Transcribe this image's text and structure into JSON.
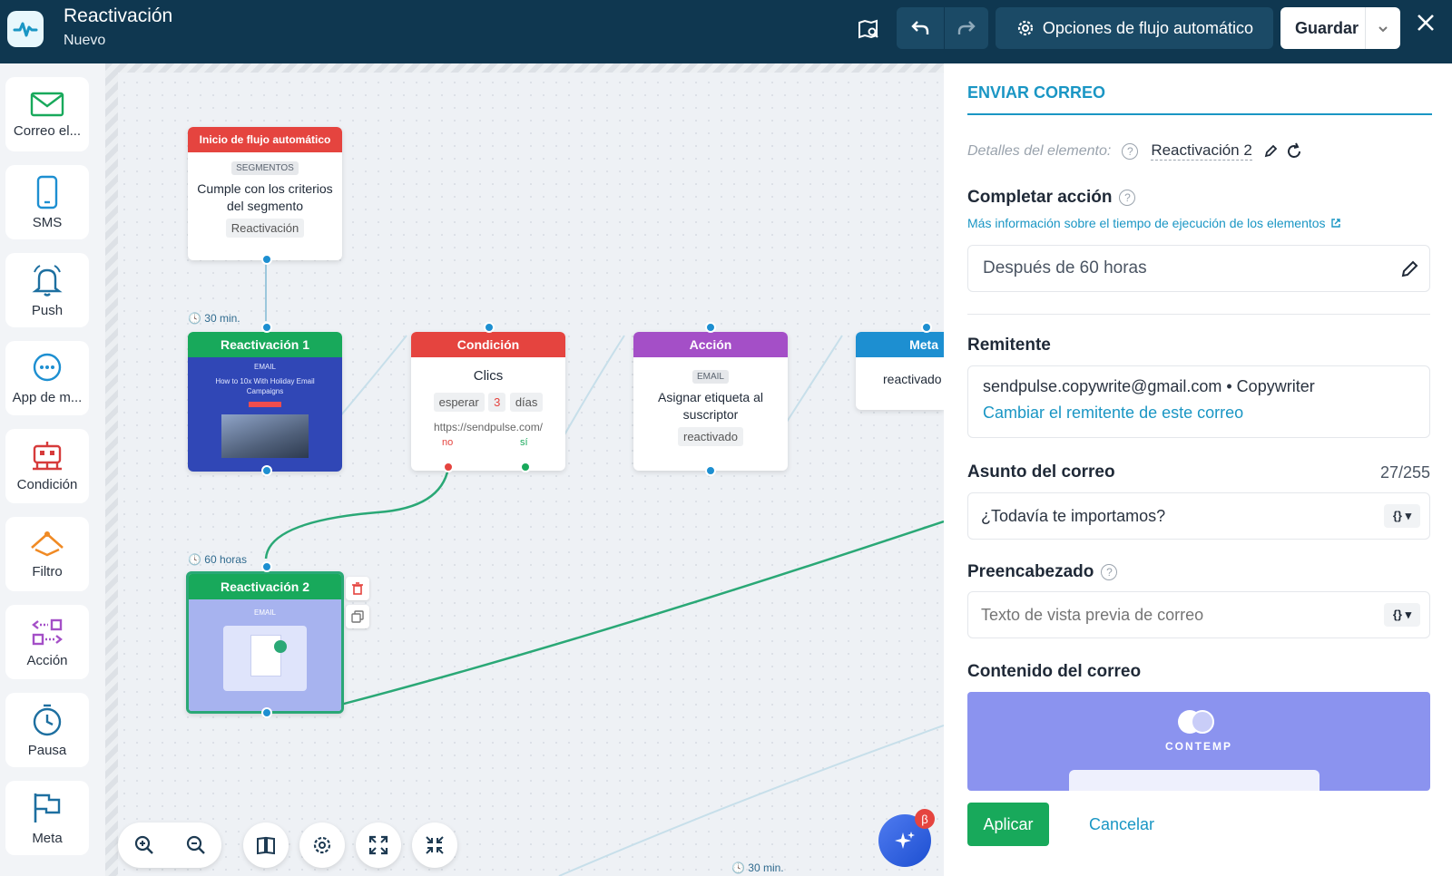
{
  "header": {
    "title": "Reactivación",
    "subtitle": "Nuevo",
    "options_label": "Opciones de flujo automático",
    "save_label": "Guardar"
  },
  "sidebar": {
    "items": [
      {
        "label": "Correo el...",
        "icon": "envelope-icon"
      },
      {
        "label": "SMS",
        "icon": "phone-icon"
      },
      {
        "label": "Push",
        "icon": "bell-icon"
      },
      {
        "label": "App de m...",
        "icon": "chat-bubble-icon"
      },
      {
        "label": "Condición",
        "icon": "robot-icon"
      },
      {
        "label": "Filtro",
        "icon": "filter-icon"
      },
      {
        "label": "Acción",
        "icon": "action-icon"
      },
      {
        "label": "Pausa",
        "icon": "clock-icon"
      },
      {
        "label": "Meta",
        "icon": "flag-icon"
      }
    ]
  },
  "canvas": {
    "start_node": {
      "head": "Inicio de flujo automático",
      "tag": "SEGMENTOS",
      "text": "Cumple con los criterios del segmento",
      "chip": "Reactivación"
    },
    "timer1": "30 min.",
    "email1": {
      "head": "Reactivación 1",
      "tag": "EMAIL",
      "preview_text": "How to 10x With Holiday Email Campaigns"
    },
    "condition": {
      "head": "Condición",
      "text": "Clics",
      "wait": "esperar",
      "wait_num": "3",
      "wait_unit": "días",
      "url": "https://sendpulse.com/",
      "no": "no",
      "yes": "sí"
    },
    "action": {
      "head": "Acción",
      "tag": "EMAIL",
      "text": "Asignar etiqueta al suscriptor",
      "chip": "reactivado"
    },
    "goal": {
      "head": "Meta",
      "text": "reactivado"
    },
    "timer2": "60 horas",
    "email2": {
      "head": "Reactivación 2",
      "tag": "EMAIL"
    },
    "timer3": "30 min.",
    "beta_badge": "β"
  },
  "colors": {
    "start": "#e5443f",
    "email": "#18a95b",
    "condition": "#e5443f",
    "action": "#a44fc7",
    "goal": "#1d8fd1",
    "accent": "#1a96c4",
    "apply": "#18a95b"
  },
  "panel": {
    "title": "ENVIAR CORREO",
    "details_label": "Detalles del elemento:",
    "details_name": "Reactivación 2",
    "complete_label": "Completar acción",
    "more_info": "Más información sobre el tiempo de ejecución de los elementos",
    "complete_value": "Después de 60 horas",
    "sender_label": "Remitente",
    "sender_value": "sendpulse.copywrite@gmail.com • Copywriter",
    "sender_change": "Cambiar el remitente de este correo",
    "subject_label": "Asunto del correo",
    "subject_count": "27/255",
    "subject_value": "¿Todavía te importamos?",
    "preheader_label": "Preencabezado",
    "preheader_placeholder": "Texto de vista previa de correo",
    "content_label": "Contenido del correo",
    "content_brand": "CONTEMP",
    "apply_label": "Aplicar",
    "cancel_label": "Cancelar"
  }
}
